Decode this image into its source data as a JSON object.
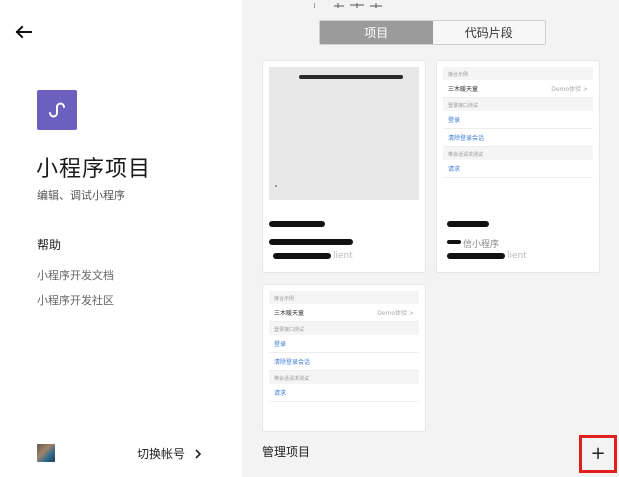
{
  "left": {
    "title": "小程序项目",
    "subtitle": "编辑、调试小程序",
    "help_title": "帮助",
    "help_links": [
      "小程序开发文档",
      "小程序开发社区"
    ],
    "switch_account": "切换帐号",
    "logo_color": "#6c5fbe"
  },
  "tabs": [
    {
      "label": "项目",
      "active": true
    },
    {
      "label": "代码片段",
      "active": false
    }
  ],
  "cards": [
    {
      "preview": "blank",
      "faint_text": ""
    },
    {
      "preview": "mini",
      "faint_text": "lient",
      "sub_text": "信小程序",
      "mini": {
        "sections": [
          {
            "header": "接合示例",
            "rows": [
              {
                "text": "三木暖天童",
                "right": "Demo体验 >"
              }
            ]
          },
          {
            "header": "登录接口测试",
            "rows": [
              {
                "text": "登录",
                "link": true
              },
              {
                "text": "清除登录会话",
                "link": true
              }
            ]
          },
          {
            "header": "带会话请求测试",
            "rows": [
              {
                "text": "请求",
                "link": true
              }
            ]
          }
        ]
      }
    },
    {
      "preview": "mini",
      "faint_text": "lient",
      "mini": {
        "sections": [
          {
            "header": "接合示例",
            "rows": [
              {
                "text": "三木暖天童",
                "right": "Demo体验 >"
              }
            ]
          },
          {
            "header": "登录接口测试",
            "rows": [
              {
                "text": "登录",
                "link": true
              },
              {
                "text": "清除登录会话",
                "link": true
              }
            ]
          },
          {
            "header": "带会话请求测试",
            "rows": [
              {
                "text": "请求",
                "link": true
              }
            ]
          }
        ]
      }
    }
  ],
  "footer": {
    "manage": "管理项目",
    "add_symbol": "+"
  },
  "colors": {
    "accent_highlight": "#e0201f",
    "tab_active": "#9b9b9b",
    "link": "#3d7bd6"
  }
}
